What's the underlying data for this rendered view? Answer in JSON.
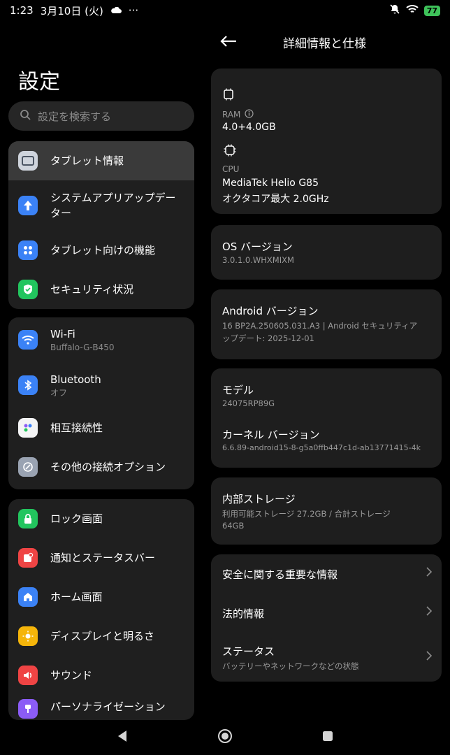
{
  "status_bar": {
    "time": "1:23",
    "date": "3月10日 (火)",
    "more": "···",
    "battery": "77"
  },
  "left": {
    "title": "設定",
    "search_placeholder": "設定を検索する",
    "groups": [
      [
        {
          "label": "タブレット情報",
          "icon": "tablet-icon",
          "color": "#cfd4dc"
        },
        {
          "label": "システムアプリアップデーター",
          "icon": "arrow-up-icon",
          "color": "#3b82f6"
        },
        {
          "label": "タブレット向けの機能",
          "icon": "grid-icon",
          "color": "#3b82f6"
        },
        {
          "label": "セキュリティ状況",
          "icon": "shield-icon",
          "color": "#22c55e"
        }
      ],
      [
        {
          "label": "Wi-Fi",
          "sub": "Buffalo-G-B450",
          "icon": "wifi-icon",
          "color": "#3b82f6"
        },
        {
          "label": "Bluetooth",
          "sub": "オフ",
          "icon": "bluetooth-icon",
          "color": "#3b82f6"
        },
        {
          "label": "相互接続性",
          "icon": "interconnect-icon",
          "color": "#f4f4f5"
        },
        {
          "label": "その他の接続オプション",
          "icon": "link-icon",
          "color": "#9aa3b2"
        }
      ],
      [
        {
          "label": "ロック画面",
          "icon": "lock-icon",
          "color": "#22c55e"
        },
        {
          "label": "通知とステータスバー",
          "icon": "notification-icon",
          "color": "#ef4444"
        },
        {
          "label": "ホーム画面",
          "icon": "home-icon",
          "color": "#3b82f6"
        },
        {
          "label": "ディスプレイと明るさ",
          "icon": "sun-icon",
          "color": "#f5b50a"
        },
        {
          "label": "サウンド",
          "icon": "speaker-icon",
          "color": "#ef4444"
        },
        {
          "label": "パーソナライゼーション",
          "icon": "brush-icon",
          "color": "#8b5cf6"
        }
      ]
    ]
  },
  "right": {
    "title": "詳細情報と仕様",
    "ram_label": "RAM",
    "ram_value": "4.0+4.0GB",
    "cpu_label": "CPU",
    "cpu_value1": "MediaTek Helio G85",
    "cpu_value2": "オクタコア最大 2.0GHz",
    "os_title": "OS バージョン",
    "os_value": "3.0.1.0.WHXMIXM",
    "android_title": "Android バージョン",
    "android_value1": "16 BP2A.250605.031.A3 | Android セキュリティア",
    "android_value2": "ップデート: 2025-12-01",
    "model_title": "モデル",
    "model_value": "24075RP89G",
    "kernel_title": "カーネル バージョン",
    "kernel_value": "6.6.89-android15-8-g5a0ffb447c1d-ab13771415-4k",
    "storage_title": "内部ストレージ",
    "storage_value1": "利用可能ストレージ  27.2GB / 合計ストレージ",
    "storage_value2": "64GB",
    "safety_title": "安全に関する重要な情報",
    "legal_title": "法的情報",
    "status_title": "ステータス",
    "status_sub": "バッテリーやネットワークなどの状態"
  }
}
